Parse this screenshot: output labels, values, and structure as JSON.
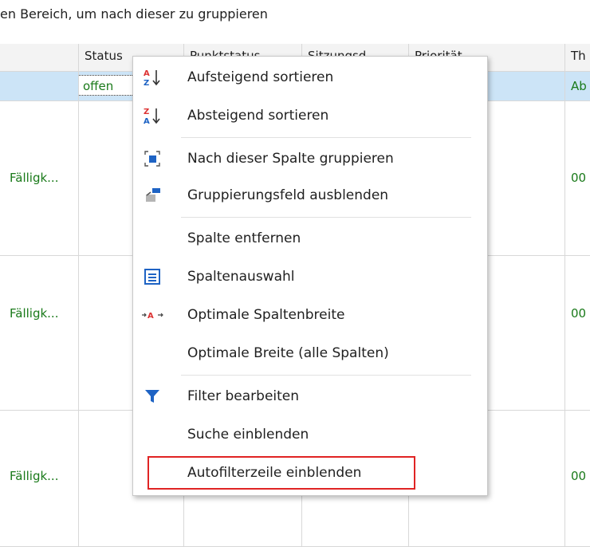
{
  "group_panel": {
    "hint": "en Bereich, um nach dieser zu gruppieren"
  },
  "columns": [
    "Status",
    "Punktstatus",
    "Sitzungsd...",
    "Priorität",
    "Th"
  ],
  "selected_row": {
    "status": "offen",
    "th": "Ab"
  },
  "rows": [
    {
      "first": "Fälligk...",
      "th": "00"
    },
    {
      "first": "Fälligk...",
      "th": "00"
    },
    {
      "first": "Fälligk...",
      "th": "00"
    }
  ],
  "menu": {
    "items": [
      {
        "label": "Aufsteigend sortieren",
        "icon": "sort-ascending-icon"
      },
      {
        "label": "Absteigend sortieren",
        "icon": "sort-descending-icon"
      },
      {
        "label": "Nach dieser Spalte gruppieren",
        "icon": "group-by-column-icon"
      },
      {
        "label": "Gruppierungsfeld ausblenden",
        "icon": "hide-group-panel-icon"
      },
      {
        "label": "Spalte entfernen",
        "icon": ""
      },
      {
        "label": "Spaltenauswahl",
        "icon": "column-chooser-icon"
      },
      {
        "label": "Optimale Spaltenbreite",
        "icon": "best-fit-icon"
      },
      {
        "label": "Optimale Breite (alle Spalten)",
        "icon": ""
      },
      {
        "label": "Filter bearbeiten",
        "icon": "filter-icon"
      },
      {
        "label": "Suche einblenden",
        "icon": ""
      },
      {
        "label": "Autofilterzeile einblenden",
        "icon": ""
      }
    ],
    "highlighted_item": "Autofilterzeile einblenden"
  },
  "colors": {
    "accent_blue": "#1e63c4",
    "highlight_red": "#e02424",
    "value_green": "#1a7a1a",
    "selected_row": "#cce4f7"
  }
}
